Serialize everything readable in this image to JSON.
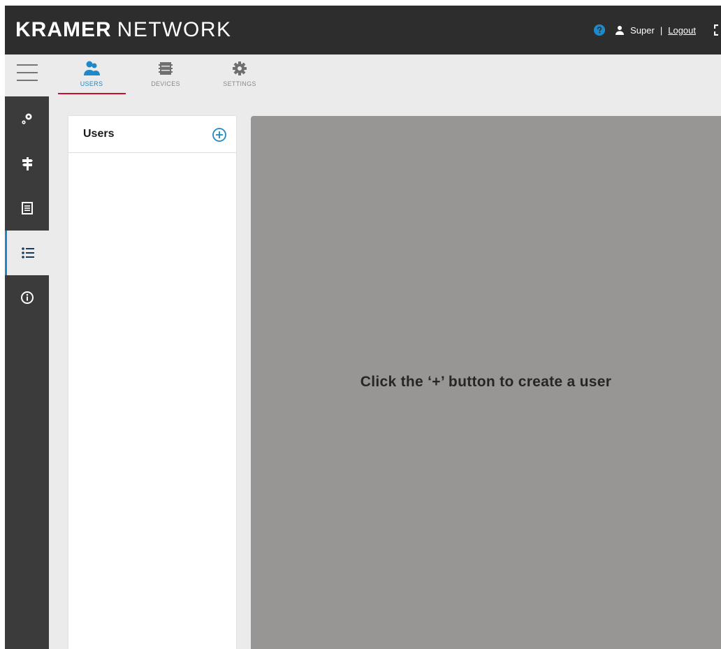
{
  "header": {
    "brand_bold": "KRAMER",
    "brand_light": "NETWORK",
    "username": "Super",
    "separator": "|",
    "logout_label": "Logout"
  },
  "tabs": [
    {
      "label": "USERS",
      "icon": "users-icon",
      "active": true
    },
    {
      "label": "DEVICES",
      "icon": "devices-icon",
      "active": false
    },
    {
      "label": "SETTINGS",
      "icon": "settings-gear-icon",
      "active": false
    }
  ],
  "rail": [
    {
      "icon": "gears-icon"
    },
    {
      "icon": "signpost-icon"
    },
    {
      "icon": "document-icon"
    },
    {
      "icon": "list-icon",
      "active": true
    },
    {
      "icon": "info-icon"
    }
  ],
  "users_panel": {
    "title": "Users"
  },
  "main": {
    "empty_message": "Click the ‘+’ button to create a user"
  },
  "colors": {
    "accent": "#1e88c9",
    "tab_underline": "#c8102e",
    "header_bg": "#2d2d2d",
    "rail_bg": "#3b3b3b",
    "main_bg": "#979695"
  }
}
